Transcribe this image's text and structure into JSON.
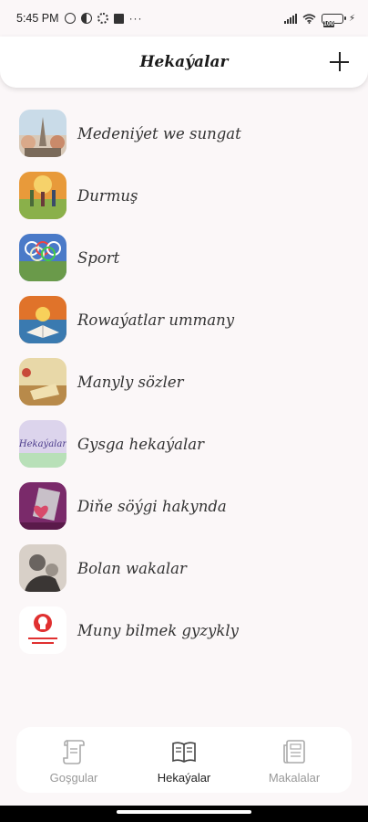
{
  "status_bar": {
    "time": "5:45 PM",
    "left_icons": [
      "alarm-icon",
      "data-saver-icon",
      "settings-icon",
      "app-icon"
    ],
    "more": "···",
    "battery": "100"
  },
  "app_bar": {
    "title": "Hekaýalar",
    "add_icon": "plus-icon"
  },
  "categories": [
    {
      "label": "Medeniýet we sungat"
    },
    {
      "label": "Durmuş"
    },
    {
      "label": "Sport"
    },
    {
      "label": "Rowaýatlar ummany"
    },
    {
      "label": "Manyly sözler"
    },
    {
      "label": "Gysga hekaýalar",
      "thumb_text": "Hekaýalar"
    },
    {
      "label": "Diňe söýgi hakynda"
    },
    {
      "label": "Bolan wakalar"
    },
    {
      "label": "Muny bilmek gyzykly"
    }
  ],
  "bottom_nav": {
    "items": [
      {
        "label": "Goşgular",
        "icon": "scroll-icon"
      },
      {
        "label": "Hekaýalar",
        "icon": "book-icon"
      },
      {
        "label": "Makalalar",
        "icon": "document-icon"
      }
    ],
    "active_index": 1
  },
  "colors": {
    "background": "#fbf7f8",
    "active": "#222222",
    "inactive": "#999999"
  }
}
